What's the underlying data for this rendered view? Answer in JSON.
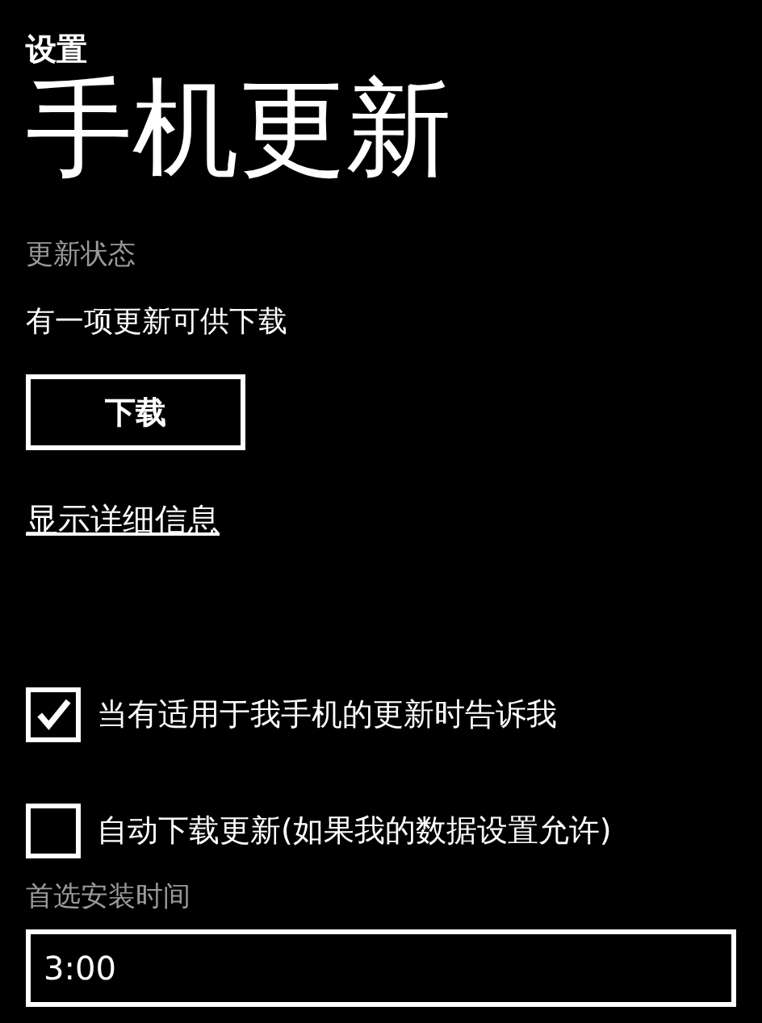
{
  "header": {
    "section": "设置",
    "title": "手机更新"
  },
  "status": {
    "label": "更新状态",
    "message": "有一项更新可供下载"
  },
  "download_button": "下载",
  "details_link": "显示详细信息",
  "options": [
    {
      "label": "当有适用于我手机的更新时告诉我",
      "checked": true
    },
    {
      "label": "自动下载更新(如果我的数据设置允许)",
      "checked": false
    }
  ],
  "install_time": {
    "label": "首选安装时间",
    "value": "3:00"
  }
}
